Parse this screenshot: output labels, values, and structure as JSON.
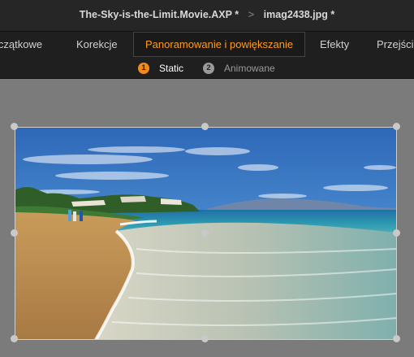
{
  "breadcrumb": {
    "project": "The-Sky-is-the-Limit.Movie.AXP",
    "project_modified": "*",
    "separator": ">",
    "file": "imag2438.jpg",
    "file_modified": "*"
  },
  "tabs": [
    {
      "label": "Początkowe",
      "active": false
    },
    {
      "label": "Korekcje",
      "active": false
    },
    {
      "label": "Panoramowanie i powiększanie",
      "active": true
    },
    {
      "label": "Efekty",
      "active": false
    },
    {
      "label": "Przejścia",
      "active": false
    }
  ],
  "subtabs": [
    {
      "number": "1",
      "label": "Static",
      "active": true
    },
    {
      "number": "2",
      "label": "Animowane",
      "active": false
    }
  ],
  "preview": {
    "image": "beach-photo",
    "handles": [
      "top-left",
      "top-middle",
      "top-right",
      "middle-left",
      "center",
      "middle-right",
      "bottom-left",
      "bottom-middle",
      "bottom-right"
    ]
  },
  "colors": {
    "accent": "#ff9c1e",
    "titlebar": "#262626",
    "toolbar": "#1f1f1f",
    "canvas": "#7b7b7b"
  }
}
